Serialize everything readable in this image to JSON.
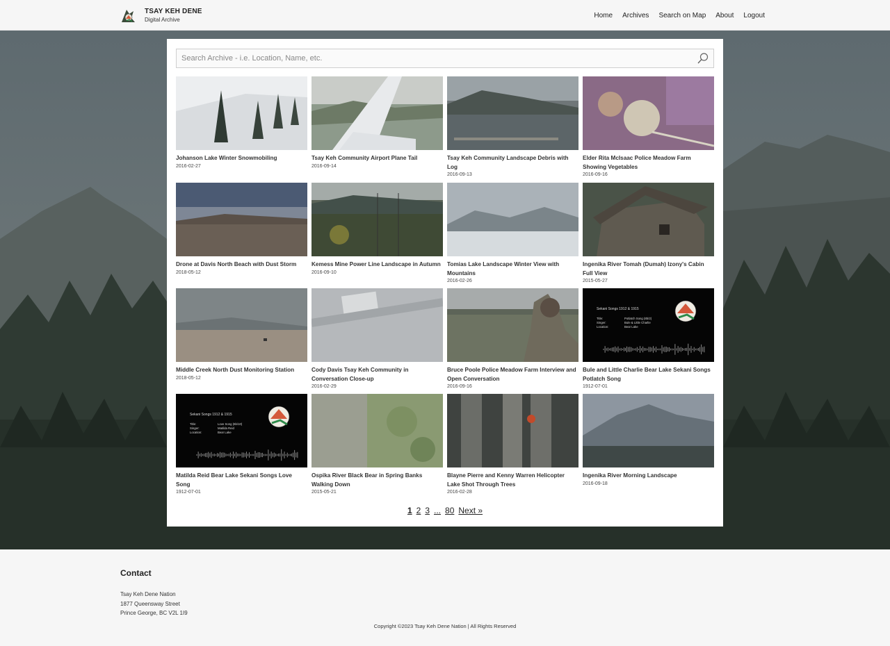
{
  "brand": {
    "title": "TSAY KEH DENE",
    "subtitle": "Digital Archive",
    "logo_icon": "eagle-feather-logo"
  },
  "nav": [
    "Home",
    "Archives",
    "Search on Map",
    "About",
    "Logout"
  ],
  "search": {
    "placeholder": "Search Archive - i.e. Location, Name, etc.",
    "value": "",
    "icon": "search-icon"
  },
  "cards": [
    {
      "title": "Johanson Lake Winter Snowmobiling",
      "date": "2016-02-27",
      "scene": "snow"
    },
    {
      "title": "Tsay Keh Community Airport Plane Tail",
      "date": "2016-09-14",
      "scene": "plane"
    },
    {
      "title": "Tsay Keh Community Landscape Debris with Log",
      "date": "2016-09-13",
      "scene": "lake"
    },
    {
      "title": "Elder Rita McIsaac Police Meadow Farm Showing Vegetables",
      "date": "2016-09-16",
      "scene": "vegetable"
    },
    {
      "title": "Drone at Davis North Beach with Dust Storm",
      "date": "2018-05-12",
      "scene": "dusk"
    },
    {
      "title": "Kemess Mine Power Line Landscape in Autumn",
      "date": "2016-09-10",
      "scene": "forest"
    },
    {
      "title": "Tomias Lake Landscape Winter View with Mountains",
      "date": "2016-02-26",
      "scene": "winterlake"
    },
    {
      "title": "Ingenika River Tomah (Dumah) Izony's Cabin Full View",
      "date": "2015-05-27",
      "scene": "cabin"
    },
    {
      "title": "Middle Creek North Dust Monitoring Station",
      "date": "2018-05-12",
      "scene": "flat"
    },
    {
      "title": "Cody Davis Tsay Keh Community in Conversation Close-up",
      "date": "2016-02-29",
      "scene": "closeup"
    },
    {
      "title": "Bruce Poole Police Meadow Farm Interview and Open Conversation",
      "date": "2016-09-16",
      "scene": "person"
    },
    {
      "title": "Bule and Little Charlie Bear Lake Sekani Songs Potlatch Song",
      "date": "1912-07-01",
      "scene": "audio",
      "audio": {
        "heading": "Sekani Songs 1912 & 1915",
        "rows": [
          [
            "Title:",
            "Potlatch Song (8b/2)"
          ],
          [
            "Singer:",
            "Bule & Little Charlie"
          ],
          [
            "Location:",
            "Bear Lake"
          ]
        ]
      }
    },
    {
      "title": "Matilda Reid Bear Lake Sekani Songs Love Song",
      "date": "1912-07-01",
      "scene": "audio",
      "audio": {
        "heading": "Sekani Songs 1912 & 1915",
        "rows": [
          [
            "Title:",
            "Love Song (6b/10)"
          ],
          [
            "Singer:",
            "Matilda Reid"
          ],
          [
            "Location:",
            "Bear Lake"
          ]
        ]
      }
    },
    {
      "title": "Ospika River Black Bear in Spring Banks Walking Down",
      "date": "2015-05-21",
      "scene": "grass"
    },
    {
      "title": "Blayne Pierre and Kenny Warren Helicopter Lake Shot Through Trees",
      "date": "2016-02-28",
      "scene": "trees"
    },
    {
      "title": "Ingenika River Morning Landscape",
      "date": "2016-09-18",
      "scene": "mountain"
    }
  ],
  "pagination": {
    "pages": [
      "1",
      "2",
      "3",
      "...",
      "80"
    ],
    "current": "1",
    "next": "Next »"
  },
  "footer": {
    "contact_heading": "Contact",
    "address": [
      "Tsay Keh Dene Nation",
      "1877 Queensway Street",
      "Prince George, BC V2L 1I9"
    ],
    "copyright": "Copyright ©2023 Tsay Keh Dene Nation | All Rights Reserved"
  }
}
